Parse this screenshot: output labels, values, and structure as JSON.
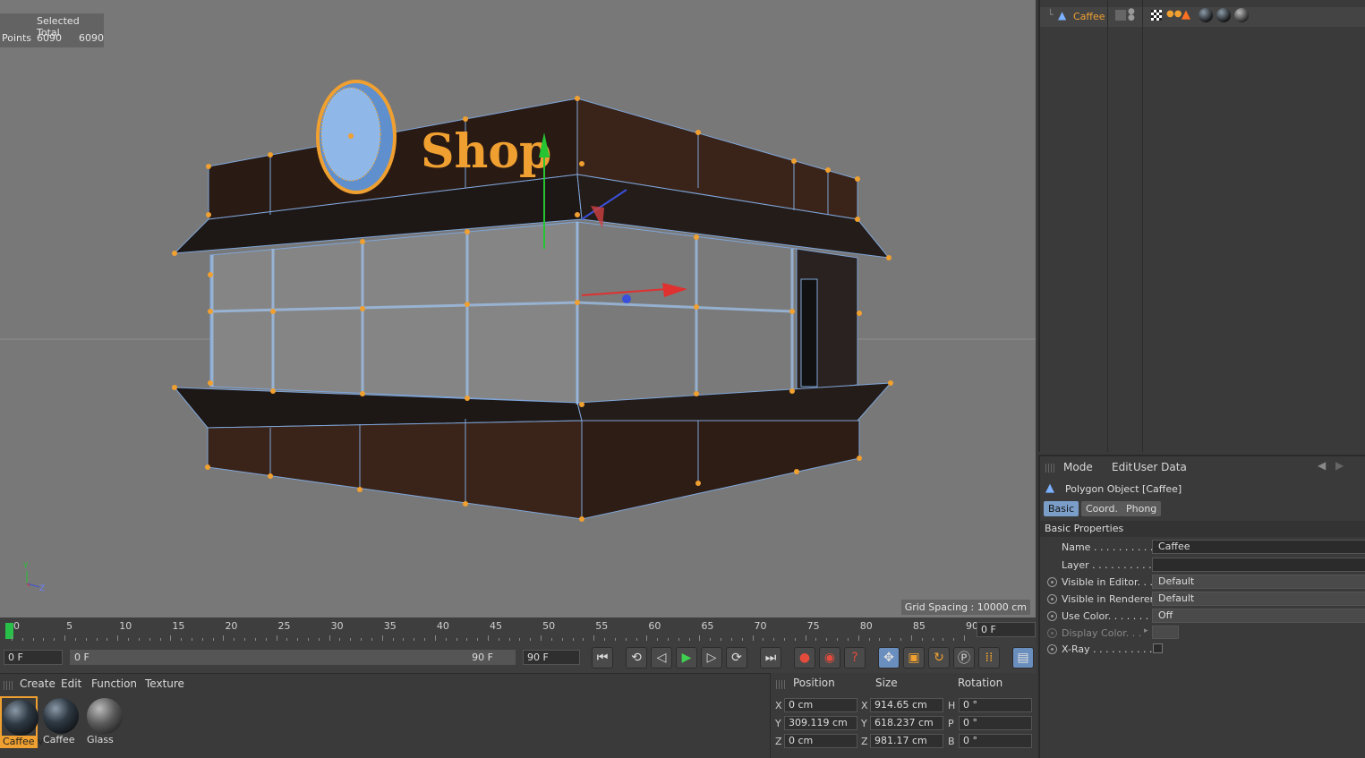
{
  "viewport": {
    "hud": {
      "header": "Selected Total",
      "row_label": "Points",
      "selected": "6090",
      "total": "6090"
    },
    "grid_spacing": "Grid Spacing : 10000 cm",
    "sign_text": "Shop",
    "axis_labels": {
      "y": "Y",
      "z": "Z"
    }
  },
  "timeline": {
    "ticks": [
      "0",
      "5",
      "10",
      "15",
      "20",
      "25",
      "30",
      "35",
      "40",
      "45",
      "50",
      "55",
      "60",
      "65",
      "70",
      "75",
      "80",
      "85",
      "90"
    ],
    "current_frame": "0 F"
  },
  "transport": {
    "start_field": "0 F",
    "range_start": "0 F",
    "range_end": "90 F",
    "end_field": "90 F",
    "buttons": [
      "go-to-start-icon",
      "previous-key-icon",
      "step-back-icon",
      "play-icon",
      "step-forward-icon",
      "next-key-icon",
      "go-to-end-icon",
      "record-icon",
      "autokey-icon",
      "keyframe-selection-icon",
      "move-icon",
      "scale-icon",
      "rotate-icon",
      "parameter-icon",
      "point-level-icon",
      "timeline-icon"
    ]
  },
  "material_manager": {
    "menu": [
      "Create",
      "Edit",
      "Function",
      "Texture"
    ],
    "materials": [
      {
        "label": "Caffee v",
        "selected": true
      },
      {
        "label": "Caffee",
        "selected": false
      },
      {
        "label": "Glass",
        "selected": false
      }
    ]
  },
  "coordinates": {
    "headers": {
      "position": "Position",
      "size": "Size",
      "rotation": "Rotation"
    },
    "rows": [
      {
        "axis": "X",
        "position": "0 cm",
        "size_axis": "X",
        "size": "914.65 cm",
        "rot_axis": "H",
        "rotation": "0 °"
      },
      {
        "axis": "Y",
        "position": "309.119 cm",
        "size_axis": "Y",
        "size": "618.237 cm",
        "rot_axis": "P",
        "rotation": "0 °"
      },
      {
        "axis": "Z",
        "position": "0 cm",
        "size_axis": "Z",
        "size": "981.17 cm",
        "rot_axis": "B",
        "rotation": "0 °"
      }
    ]
  },
  "object_manager": {
    "object_name": "Caffee"
  },
  "attribute_manager": {
    "menu": [
      "Mode",
      "Edit",
      "User Data"
    ],
    "title": "Polygon Object [Caffee]",
    "tabs": [
      "Basic",
      "Coord.",
      "Phong"
    ],
    "active_tab": "Basic",
    "section": "Basic Properties",
    "properties": [
      {
        "label": "Name . . . . . . . . . . .",
        "value": "Caffee"
      },
      {
        "label": "Layer . . . . . . . . . . . .",
        "value": ""
      },
      {
        "label": "Visible in Editor. . .",
        "value": "Default"
      },
      {
        "label": "Visible in Renderer",
        "value": "Default"
      },
      {
        "label": "Use Color. . . . . . . .",
        "value": "Off"
      },
      {
        "label": "Display Color. . .",
        "value": ""
      },
      {
        "label": "X-Ray . . . . . . . . . . .",
        "value": ""
      }
    ]
  }
}
